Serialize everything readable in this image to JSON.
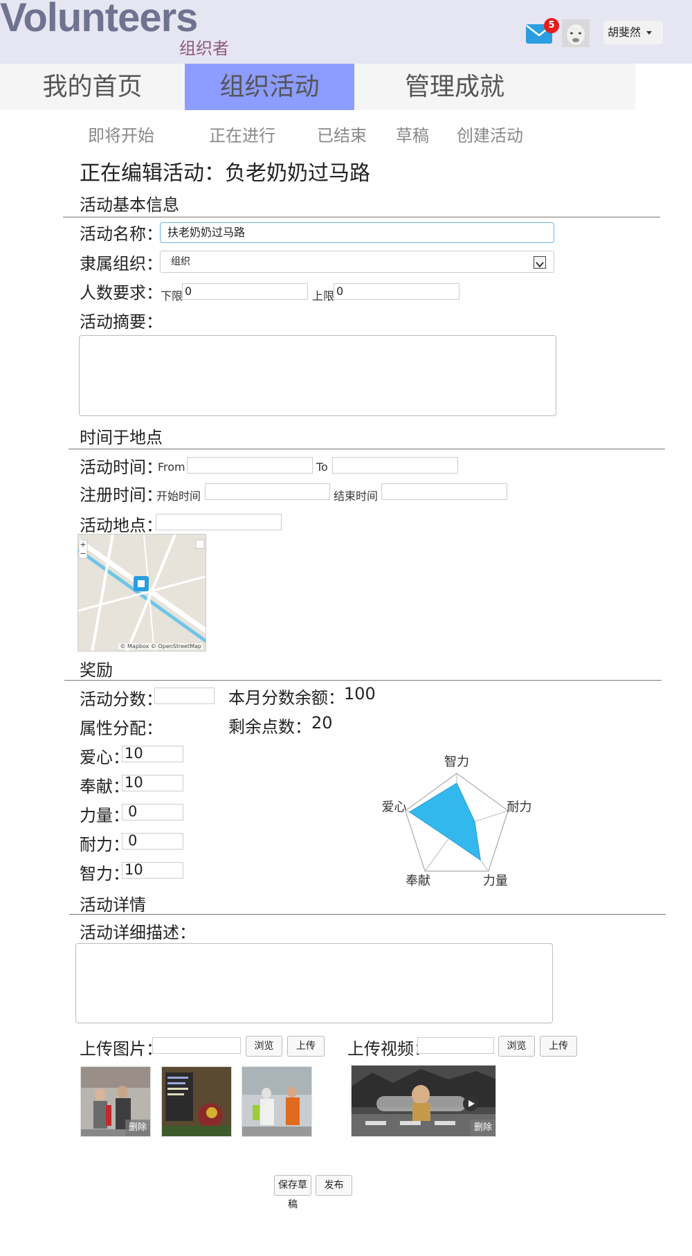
{
  "header": {
    "logo": "Volunteers",
    "role": "组织者",
    "mail_count": "5",
    "user_name": "胡斐然"
  },
  "nav": {
    "tabs": [
      {
        "label": "我的首页"
      },
      {
        "label": "组织活动",
        "active": true
      },
      {
        "label": "管理成就"
      }
    ],
    "subtabs": [
      "即将开始",
      "正在进行",
      "已结束",
      "草稿",
      "创建活动"
    ]
  },
  "editor": {
    "title": "正在编辑活动：负老奶奶过马路",
    "basic_section": "活动基本信息",
    "name_label": "活动名称：",
    "name_value": "扶老奶奶过马路",
    "org_label": "隶属组织：",
    "org_value": "组织",
    "people_label": "人数要求：",
    "min_label": "下限",
    "min_value": "0",
    "max_label": "上限",
    "max_value": "0",
    "summary_label": "活动摘要：",
    "time_section": "时间于地点",
    "activity_time_label": "活动时间：",
    "from_label": "From",
    "to_label": "To",
    "register_time_label": "注册时间：",
    "start_label": "开始时间",
    "end_label": "结束时间",
    "location_label": "活动地点：",
    "map_attribution": "© Mapbox © OpenStreetMap",
    "reward_section": "奖励",
    "score_label": "活动分数：",
    "month_balance_label": "本月分数余额：",
    "month_balance_value": "100",
    "attr_label": "属性分配：",
    "remaining_label": "剩余点数：",
    "remaining_value": "20",
    "attributes": [
      {
        "label": "爱心：",
        "value": "10"
      },
      {
        "label": "奉献：",
        "value": "10"
      },
      {
        "label": "力量：",
        "value": "0"
      },
      {
        "label": "耐力：",
        "value": "0"
      },
      {
        "label": "智力：",
        "value": "10"
      }
    ],
    "detail_section": "活动详情",
    "detail_label": "活动详细描述：",
    "upload_image_label": "上传图片：",
    "upload_video_label": "上传视频：",
    "browse_label": "浏览",
    "upload_label": "上传",
    "delete_label": "删除",
    "save_draft_label": "保存草稿",
    "publish_label": "发布"
  },
  "radar": {
    "labels": [
      "智力",
      "耐力",
      "力量",
      "奉献",
      "爱心"
    ],
    "values": [
      0.82,
      0.35,
      0.75,
      0.25,
      0.92
    ],
    "fill_color": "#33b8ee"
  },
  "colors": {
    "topbar": "#e6e6f2",
    "active_tab": "#8c9cff",
    "logo": "#6e7390",
    "role": "#8a5a7a"
  }
}
